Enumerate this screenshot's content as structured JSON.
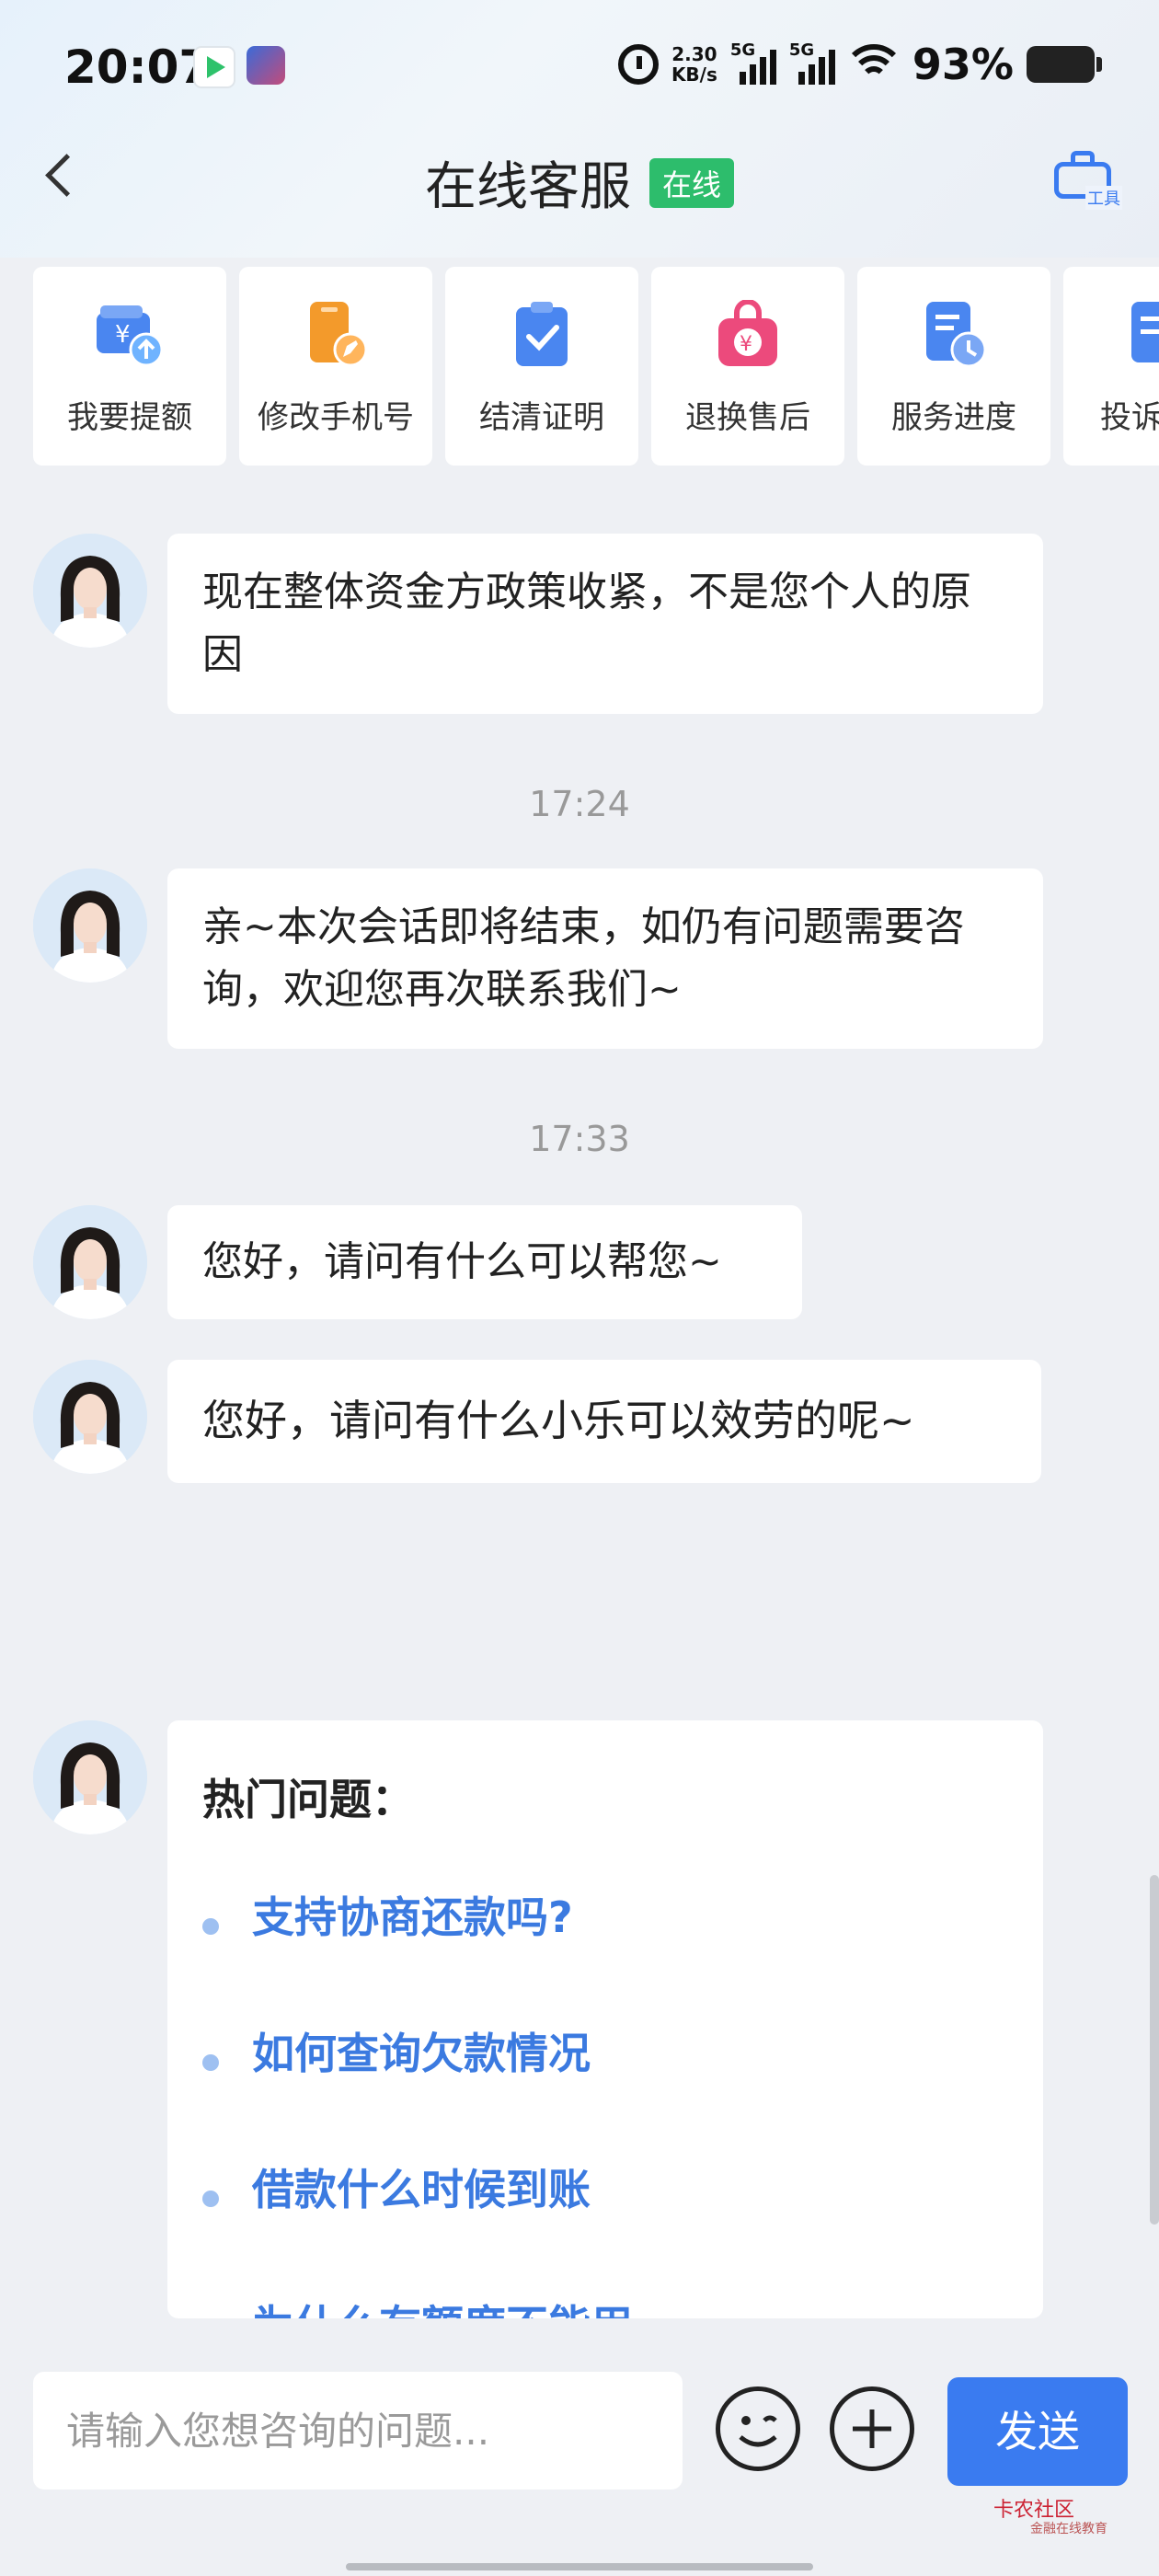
{
  "status_bar": {
    "time": "20:07",
    "net_speed": "2.30",
    "net_unit": "KB/s",
    "signal1_label": "5G",
    "signal2_label": "5G",
    "battery": "93%"
  },
  "header": {
    "title": "在线客服",
    "status_badge": "在线",
    "tool_label": "工具"
  },
  "shortcuts": [
    {
      "label": "我要提额",
      "icon": "wallet-upload-icon"
    },
    {
      "label": "修改手机号",
      "icon": "phone-edit-icon"
    },
    {
      "label": "结清证明",
      "icon": "clipboard-check-icon"
    },
    {
      "label": "退换售后",
      "icon": "bag-yuan-icon"
    },
    {
      "label": "服务进度",
      "icon": "document-clock-icon"
    },
    {
      "label": "投诉",
      "icon": "document-icon"
    }
  ],
  "chat": {
    "msg1": "现在整体资金方政策收紧，不是您个人的原因",
    "time1": "17:24",
    "msg2": "亲~本次会话即将结束，如仍有问题需要咨询，欢迎您再次联系我们~",
    "time2": "17:33",
    "msg3": "您好，请问有什么可以帮您~",
    "msg4": "您好，请问有什么小乐可以效劳的呢~",
    "hot_title": "热门问题：",
    "hot_questions": [
      "支持协商还款吗?",
      "如何查询欠款情况",
      "借款什么时候到账",
      "为什么有额度不能用"
    ]
  },
  "input": {
    "placeholder": "请输入您想咨询的问题..."
  },
  "send_label": "发送",
  "watermark": {
    "line1": "卡农社区",
    "line2": "金融在线教育"
  },
  "colors": {
    "accent": "#3a7bf0",
    "online": "#2dbd6c",
    "link": "#3b7ae0"
  }
}
